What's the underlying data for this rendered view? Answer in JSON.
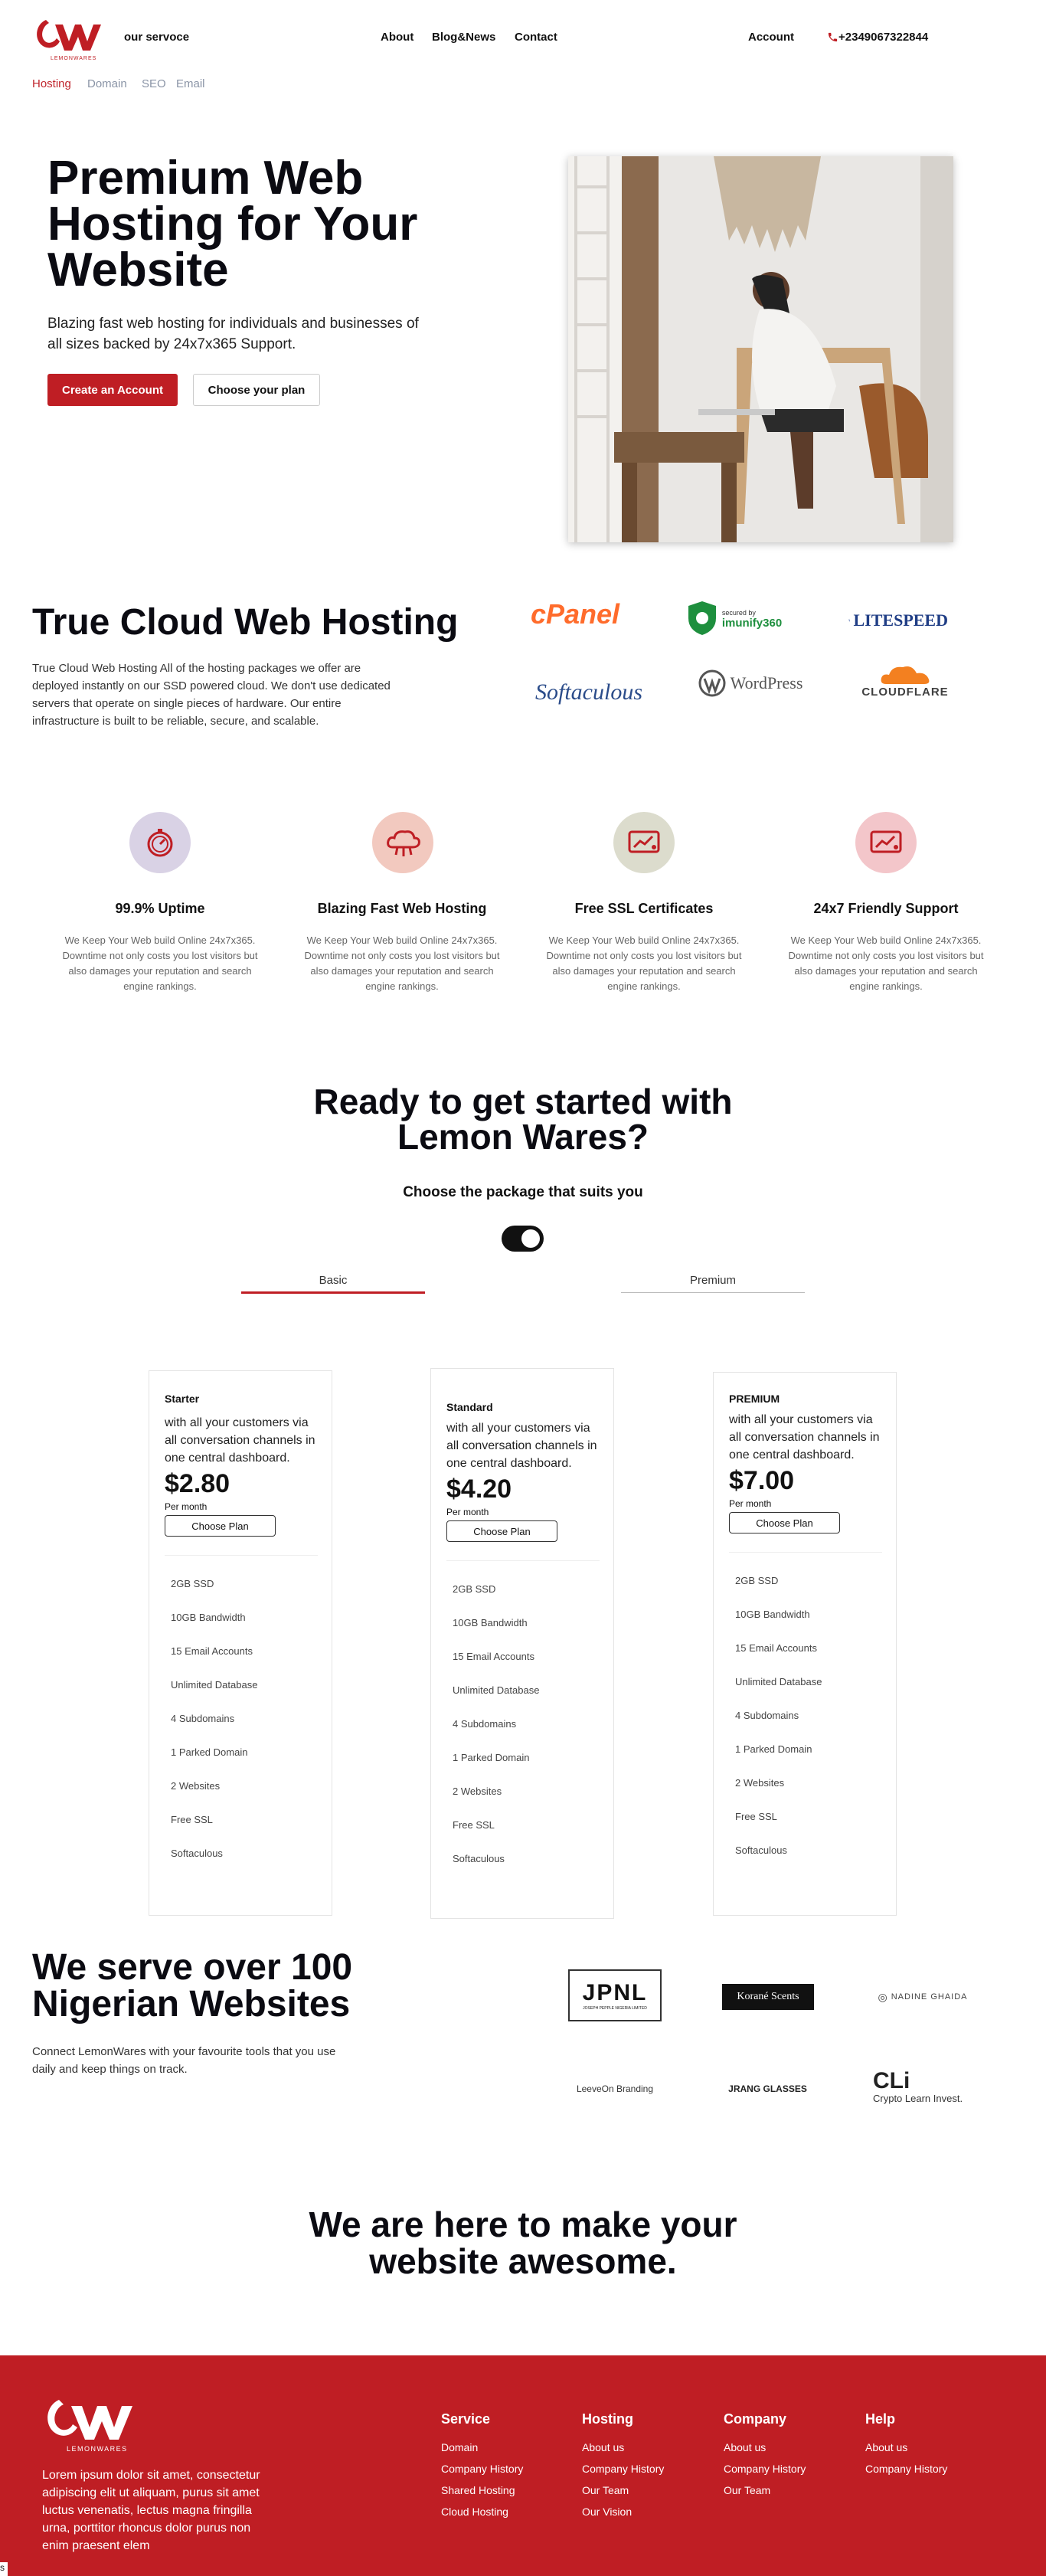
{
  "header": {
    "brand_text": "our servoce",
    "logo_name": "LEMONWARES",
    "nav": [
      "About",
      "Blog&News",
      "Contact"
    ],
    "account": "Account",
    "phone": "+2349067322844",
    "subnav": [
      "Hosting",
      "Domain",
      "SEO",
      "Email"
    ],
    "brand_color": "#bf1e24"
  },
  "hero": {
    "title": "Premium Web Hosting for Your Website",
    "subtitle": "Blazing fast web hosting for individuals and businesses of all sizes backed by 24x7x365 Support.",
    "cta_primary": "Create an Account",
    "cta_secondary": "Choose your plan"
  },
  "cloud": {
    "title": "True Cloud Web Hosting",
    "text": "True Cloud Web Hosting All of the hosting packages we offer are deployed instantly on our SSD powered cloud. We don't use dedicated servers that operate on single pieces of hardware. Our entire infrastructure is built to be reliable, secure, and scalable.",
    "partners": {
      "cpanel": "cPanel",
      "imunify_small": "secured by",
      "imunify": "imunify360",
      "litespeed": "LITESPEED",
      "softaculous": "Softaculous",
      "wordpress": "WordPress",
      "cloudflare": "CLOUDFLARE"
    }
  },
  "features": [
    {
      "title": "99.9% Uptime",
      "text": "We Keep Your Web build Online 24x7x365. Downtime not only costs you lost visitors but also damages your reputation and search engine rankings.",
      "icon": "timer-icon",
      "bg": "#d9d2e5"
    },
    {
      "title": "Blazing Fast Web Hosting",
      "text": "We Keep Your Web build Online 24x7x365. Downtime not only costs you lost visitors but also damages your reputation and search engine rankings.",
      "icon": "cloud-icon",
      "bg": "#f2c9bf"
    },
    {
      "title": "Free SSL Certificates",
      "text": "We Keep Your Web build Online 24x7x365. Downtime not only costs you lost visitors but also damages your reputation and search engine rankings.",
      "icon": "chart-icon",
      "bg": "#dcdccd"
    },
    {
      "title": "24x7 Friendly Support",
      "text": "We Keep Your Web build Online 24x7x365. Downtime not only costs you lost visitors but also damages your reputation and search engine rankings.",
      "icon": "chart-icon",
      "bg": "#f3c6ca"
    }
  ],
  "pricing": {
    "title": "Ready to get started with Lemon Wares?",
    "subtitle": "Choose the package that suits you",
    "tabs": [
      "Basic",
      "Premium"
    ],
    "cards": [
      {
        "name": "Starter",
        "desc": "with all your customers via all conversation channels in one central dashboard.",
        "price": "$2.80",
        "per": "Per month",
        "button": "Choose Plan",
        "features": [
          "2GB SSD",
          "10GB Bandwidth",
          "15 Email Accounts",
          "Unlimited Database",
          "4 Subdomains",
          "1 Parked Domain",
          "2 Websites",
          "Free SSL",
          "Softaculous"
        ]
      },
      {
        "name": "Standard",
        "desc": "with all your customers via all conversation channels in one central dashboard.",
        "price": "$4.20",
        "per": "Per month",
        "button": "Choose Plan",
        "features": [
          "2GB SSD",
          "10GB Bandwidth",
          "15 Email Accounts",
          "Unlimited Database",
          "4 Subdomains",
          "1 Parked Domain",
          "2 Websites",
          "Free SSL",
          "Softaculous"
        ]
      },
      {
        "name": "PREMIUM",
        "desc": "with all your customers via all conversation channels in one central dashboard.",
        "price": "$7.00",
        "per": "Per month",
        "button": "Choose Plan",
        "features": [
          "2GB SSD",
          "10GB Bandwidth",
          "15 Email Accounts",
          "Unlimited Database",
          "4 Subdomains",
          "1 Parked Domain",
          "2 Websites",
          "Free SSL",
          "Softaculous"
        ]
      }
    ]
  },
  "serve": {
    "title": "We serve over 100 Nigerian Websites",
    "text": "Connect LemonWares with your favourite tools that you use daily and keep things on track.",
    "clients": {
      "jpnl": "JPNL",
      "jpnl_small": "JOSEPH PEPPLE NIGERIA LIMITED",
      "korane": "Korané Scents",
      "nadine": "NADINE GHAIDA",
      "leeveon": "LeeveOn Branding",
      "jrang": "JRANG GLASSES",
      "cli": "CLi",
      "cli_sub": "Crypto Learn Invest."
    }
  },
  "awesome": {
    "title": "We are here to make your website awesome."
  },
  "footer": {
    "text": "Lorem ipsum dolor sit amet, consectetur adipiscing elit ut aliquam, purus sit amet luctus venenatis, lectus magna fringilla urna, porttitor rhoncus dolor purus non enim praesent elem",
    "logo_name": "LEMONWARES",
    "columns": [
      {
        "title": "Service",
        "links": [
          "Domain",
          "Company History",
          "Shared Hosting",
          "Cloud Hosting"
        ]
      },
      {
        "title": "Hosting",
        "links": [
          "About us",
          "Company History",
          "Our Team",
          "Our Vision"
        ]
      },
      {
        "title": "Company",
        "links": [
          "About us",
          "Company History",
          "Our Team"
        ]
      },
      {
        "title": "Help",
        "links": [
          "About us",
          "Company History"
        ]
      }
    ],
    "stray": "s"
  }
}
